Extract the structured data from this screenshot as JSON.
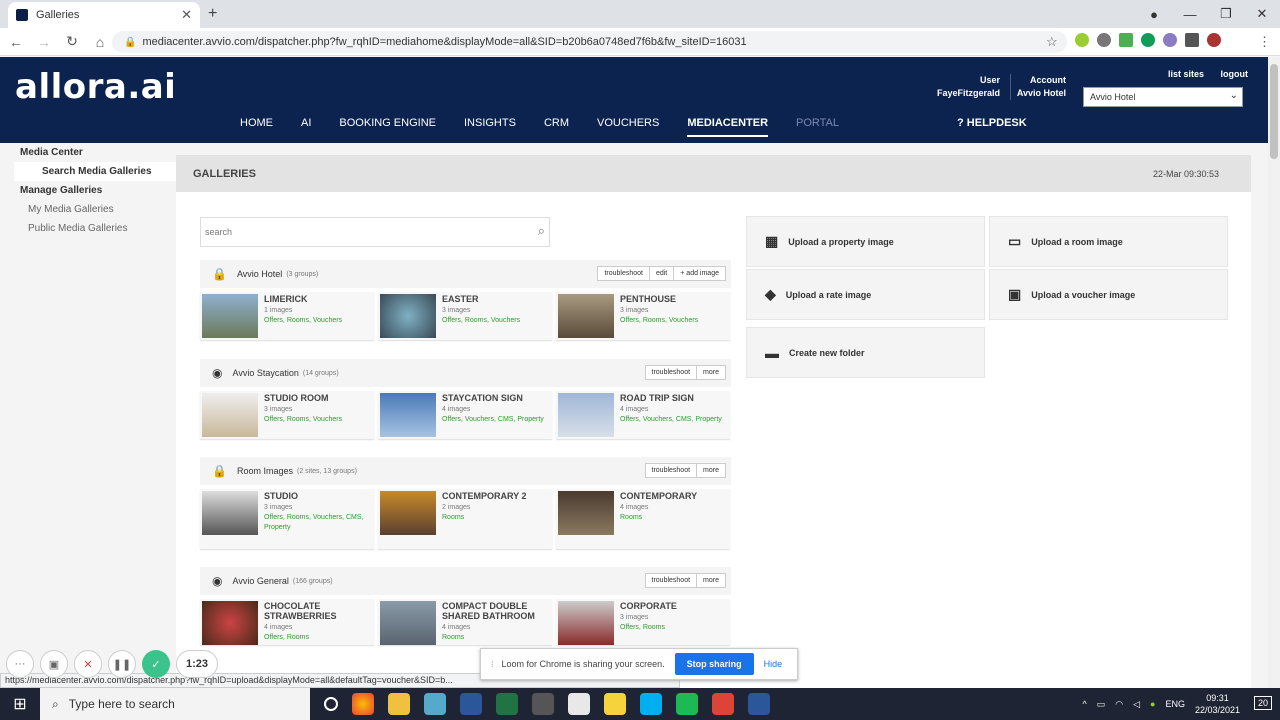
{
  "browser": {
    "tab_title": "Galleries",
    "url": "mediacenter.avvio.com/dispatcher.php?fw_rqhID=mediahome&displayMode=all&SID=b20b6a0748ed7f6b&fw_siteID=16031",
    "status_url": "https://mediacenter.avvio.com/dispatcher.php?fw_rqhID=upload&displayMode=all&defaultTag=voucher&SID=b..."
  },
  "header": {
    "logo": "allora.ai",
    "user_label": "User",
    "user_name": "FayeFitzgerald",
    "account_label": "Account",
    "account_name": "Avvio Hotel",
    "list_sites": "list sites",
    "logout": "logout",
    "hotel_select": "Avvio Hotel",
    "nav": [
      "HOME",
      "AI",
      "BOOKING ENGINE",
      "INSIGHTS",
      "CRM",
      "VOUCHERS",
      "MEDIACENTER",
      "PORTAL"
    ],
    "helpdesk": "HELPDESK"
  },
  "sidebar": {
    "media_center": "Media Center",
    "search_galleries": "Search Media Galleries",
    "manage_galleries": "Manage Galleries",
    "my_galleries": "My Media Galleries",
    "public_galleries": "Public Media Galleries"
  },
  "main": {
    "title": "GALLERIES",
    "timestamp": "22-Mar 09:30:53",
    "search_placeholder": "search",
    "groups": [
      {
        "name": "Avvio Hotel",
        "meta": "(3 groups)",
        "btns": [
          "troubleshoot",
          "edit",
          "+ add image"
        ],
        "items": [
          {
            "title": "LIMERICK",
            "count": "1 images",
            "tags": "Offers, Rooms, Vouchers"
          },
          {
            "title": "EASTER",
            "count": "3 images",
            "tags": "Offers, Rooms, Vouchers"
          },
          {
            "title": "PENTHOUSE",
            "count": "3 images",
            "tags": "Offers, Rooms, Vouchers"
          }
        ]
      },
      {
        "name": "Avvio Staycation",
        "meta": "(14 groups)",
        "btns": [
          "troubleshoot",
          "more"
        ],
        "items": [
          {
            "title": "STUDIO ROOM",
            "count": "3 images",
            "tags": "Offers, Rooms, Vouchers"
          },
          {
            "title": "STAYCATION SIGN",
            "count": "4 images",
            "tags": "Offers, Vouchers, CMS, Property"
          },
          {
            "title": "ROAD TRIP SIGN",
            "count": "4 images",
            "tags": "Offers, Vouchers, CMS, Property"
          }
        ]
      },
      {
        "name": "Room Images",
        "meta": "(2 sites, 13 groups)",
        "btns": [
          "troubleshoot",
          "more"
        ],
        "items": [
          {
            "title": "STUDIO",
            "count": "3 images",
            "tags": "Offers, Rooms, Vouchers, CMS, Property"
          },
          {
            "title": "CONTEMPORARY 2",
            "count": "2 images",
            "tags": "Rooms"
          },
          {
            "title": "CONTEMPORARY",
            "count": "4 images",
            "tags": "Rooms"
          }
        ]
      },
      {
        "name": "Avvio General",
        "meta": "(166 groups)",
        "btns": [
          "troubleshoot",
          "more"
        ],
        "items": [
          {
            "title": "CHOCOLATE STRAWBERRIES",
            "count": "4 images",
            "tags": "Offers, Rooms"
          },
          {
            "title": "COMPACT DOUBLE SHARED BATHROOM",
            "count": "4 images",
            "tags": "Rooms"
          },
          {
            "title": "CORPORATE",
            "count": "3 images",
            "tags": "Offers, Rooms"
          }
        ]
      }
    ],
    "uploads": {
      "property": "Upload a property image",
      "room": "Upload a room image",
      "rate": "Upload a rate image",
      "voucher": "Upload a voucher image",
      "folder": "Create new folder"
    }
  },
  "loom": {
    "timer": "1:23",
    "share_msg": "Loom for Chrome is sharing your screen.",
    "stop": "Stop sharing",
    "hide": "Hide"
  },
  "taskbar": {
    "search": "Type here to search",
    "lang": "ENG",
    "time": "09:31",
    "date": "22/03/2021",
    "notif": "20"
  }
}
